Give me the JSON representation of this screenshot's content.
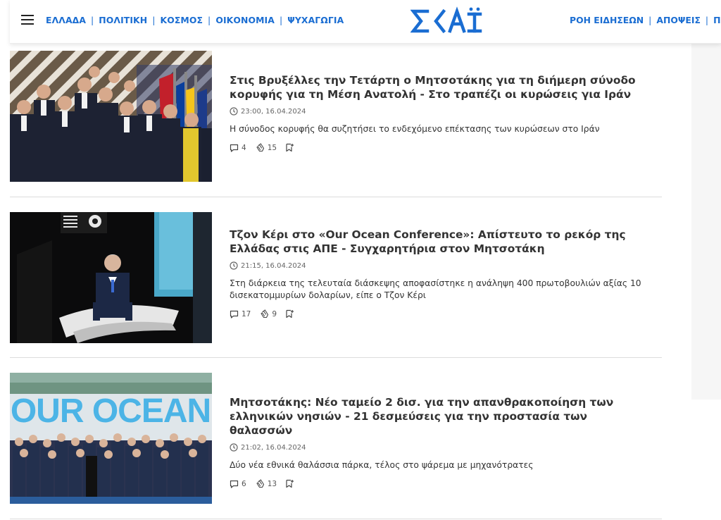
{
  "header": {
    "nav_left": [
      "ΕΛΛΑΔΑ",
      "ΠΟΛΙΤΙΚΗ",
      "ΚΟΣΜΟΣ",
      "ΟΙΚΟΝΟΜΙΑ",
      "ΨΥΧΑΓΩΓΙΑ"
    ],
    "logo_text": "ΣΚΑΪ",
    "nav_right": [
      "ΡΟΗ ΕΙΔΗΣΕΩΝ",
      "ΑΠΟΨΕΙΣ",
      "ΠΡΩΤ"
    ],
    "brand_color": "#1a6dd2"
  },
  "articles": [
    {
      "title": "Στις Βρυξέλλες την Τετάρτη ο Μητσοτάκης για τη διήμερη σύνοδο κορυφής για τη Μέση Ανατολή - Στο τραπέζι οι κυρώσεις για Ιράν",
      "time": "23:00, 16.04.2024",
      "summary": "Η σύνοδος κορυφής θα συζητήσει το ενδεχόμενο επέκτασης των κυρώσεων στο Ιράν",
      "comments": "4",
      "claps": "15"
    },
    {
      "title": "Τζον Κέρι στο «Our Ocean Conference»: Απίστευτο το ρεκόρ της Ελλάδας στις ΑΠΕ - Συγχαρητήρια στον Μητσοτάκη",
      "time": "21:15, 16.04.2024",
      "summary": "Στη διάρκεια της τελευταία διάσκεψης αποφασίστηκε η ανάληψη 400 πρωτοβουλιών αξίας 10 δισεκατομμυρίων δολαρίων, είπε ο Τζον Κέρι",
      "comments": "17",
      "claps": "9"
    },
    {
      "title": "Μητσοτάκης: Νέο ταμείο 2 δισ. για την απανθρακοποίηση των ελληνικών νησιών - 21 δεσμεύσεις για την προστασία των θαλασσών",
      "time": "21:02, 16.04.2024",
      "summary": "Δύο νέα εθνικά θαλάσσια πάρκα, τέλος στο ψάρεμα με μηχανότρατες",
      "comments": "6",
      "claps": "13",
      "photo_sign": "OUR OCEAN"
    }
  ]
}
